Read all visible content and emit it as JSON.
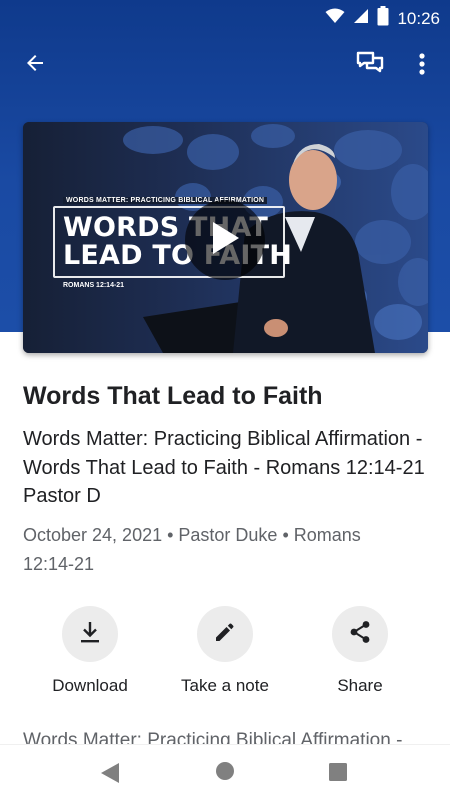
{
  "status_bar": {
    "time": "10:26",
    "icons": [
      "wifi-icon",
      "cell-signal-icon",
      "battery-icon"
    ]
  },
  "app_bar": {
    "back_icon": "arrow-back-icon",
    "chat_icon": "chat-icon",
    "more_icon": "more-vert-icon"
  },
  "video": {
    "thumbnail": {
      "eyebrow": "WORDS MATTER: PRACTICING BIBLICAL AFFIRMATION",
      "headline": "WORDS THAT LEAD TO FAITH",
      "reference": "ROMANS 12:14-21"
    },
    "play_icon": "play-icon"
  },
  "sermon": {
    "title": "Words That Lead to Faith",
    "subtitle": "Words Matter: Practicing Biblical Affirmation - Words That Lead to Faith - Romans 12:14-21  Pastor D",
    "meta": "October 24, 2021 • Pastor Duke • Romans 12:14-21"
  },
  "actions": [
    {
      "label": "Download",
      "icon": "download-icon"
    },
    {
      "label": "Take a note",
      "icon": "pencil-icon"
    },
    {
      "label": "Share",
      "icon": "share-icon"
    }
  ],
  "description_preview": "Words Matter: Practicing Biblical Affirmation -",
  "nav_bar": {
    "icons": [
      "nav-back-icon",
      "nav-home-icon",
      "nav-recents-icon"
    ]
  },
  "colors": {
    "header_blue": "#1a4aa3",
    "action_circle": "#ececec",
    "meta_gray": "#606368"
  }
}
